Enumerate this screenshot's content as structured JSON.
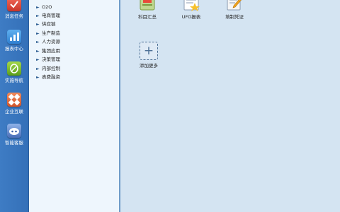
{
  "sidebar": {
    "items": [
      {
        "label": "消息任务",
        "icon": "task-icon"
      },
      {
        "label": "报表中心",
        "icon": "report-chart-icon"
      },
      {
        "label": "实施导航",
        "icon": "navigation-icon"
      },
      {
        "label": "企业互联",
        "icon": "enterprise-link-icon"
      },
      {
        "label": "智能客服",
        "icon": "service-robot-icon"
      }
    ]
  },
  "menu": {
    "items": [
      {
        "label": "O2O"
      },
      {
        "label": "电商管理"
      },
      {
        "label": "供应链"
      },
      {
        "label": "生产制造"
      },
      {
        "label": "人力资源"
      },
      {
        "label": "集团应用"
      },
      {
        "label": "决策管理"
      },
      {
        "label": "内部控制"
      },
      {
        "label": "表费融资"
      }
    ]
  },
  "content": {
    "tiles": [
      {
        "label": "科目汇总",
        "icon": "ledger-summary-icon"
      },
      {
        "label": "UFO报表",
        "icon": "ufo-report-icon"
      },
      {
        "label": "填制凭证",
        "icon": "voucher-edit-icon"
      }
    ],
    "add_more": {
      "label": "添加更多",
      "symbol": "+"
    }
  },
  "colors": {
    "sidebar_bg": "#3e7cc4",
    "menu_bg": "#eef6fd",
    "content_bg": "#d4e4f2",
    "accent": "#2f5f93"
  }
}
